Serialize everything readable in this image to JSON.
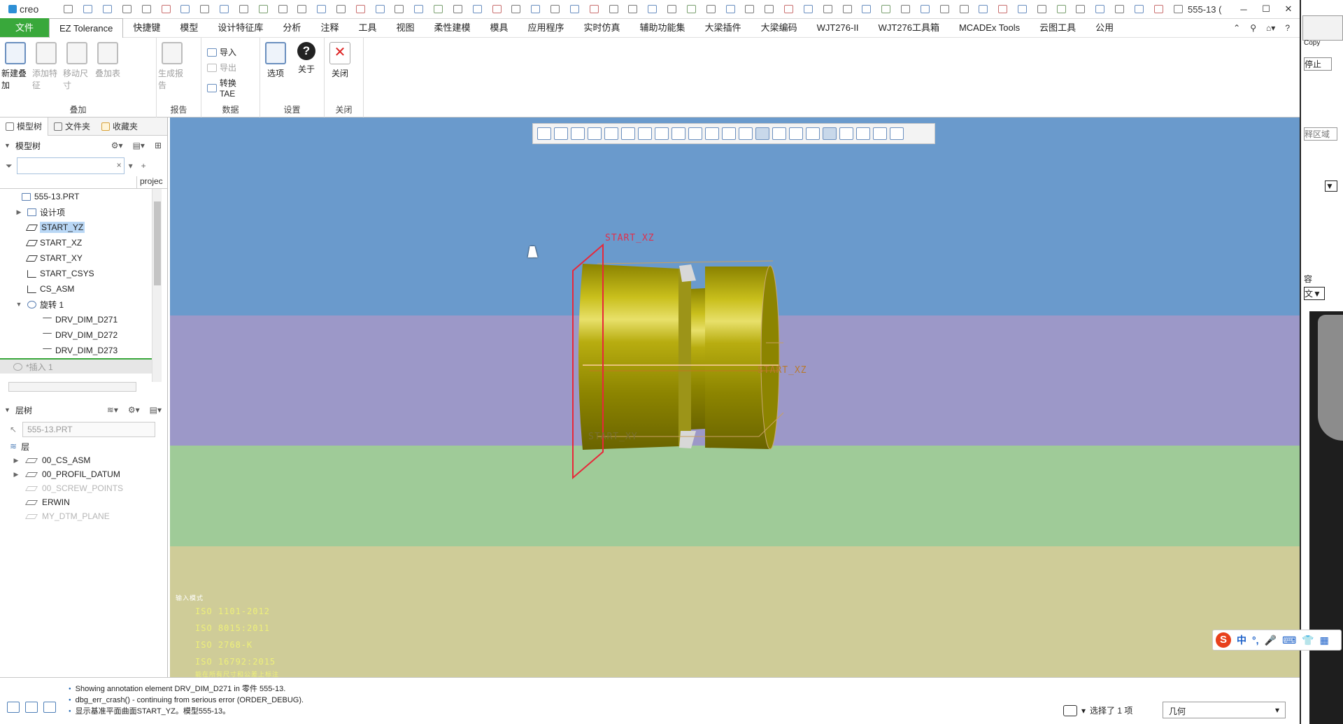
{
  "app": {
    "brand": "creo",
    "window_title": "555-13 (",
    "win_min": "─",
    "win_max": "☐",
    "win_close": "✕"
  },
  "menus": [
    "文件",
    "EZ Tolerance",
    "快捷键",
    "模型",
    "设计特征库",
    "分析",
    "注释",
    "工具",
    "视图",
    "柔性建模",
    "模具",
    "应用程序",
    "实时仿真",
    "辅助功能集",
    "大梁插件",
    "大梁编码",
    "WJT276-II",
    "WJT276工具箱",
    "MCADEx Tools",
    "云图工具",
    "公用"
  ],
  "menu_right": [
    "⌃",
    "⚲",
    "⌂▾",
    "?"
  ],
  "ribbon": {
    "groups": [
      {
        "label": "叠加",
        "buttons": [
          {
            "label": "新建叠加",
            "enabled": true
          },
          {
            "label": "添加特征",
            "enabled": false
          },
          {
            "label": "移动尺寸",
            "enabled": false
          },
          {
            "label": "叠加表",
            "enabled": false
          }
        ]
      },
      {
        "label": "报告",
        "buttons": [
          {
            "label": "生成报告",
            "enabled": false
          }
        ]
      },
      {
        "label": "数据",
        "items": [
          {
            "label": "导入",
            "enabled": true
          },
          {
            "label": "导出",
            "enabled": false
          },
          {
            "label": "转换 TAE",
            "enabled": true
          }
        ]
      },
      {
        "label": "设置",
        "buttons": [
          {
            "label": "选项",
            "enabled": true
          },
          {
            "label": "关于",
            "enabled": true
          }
        ]
      },
      {
        "label": "关闭",
        "buttons": [
          {
            "label": "关闭",
            "enabled": true
          }
        ]
      }
    ]
  },
  "panel": {
    "tabs": [
      "模型树",
      "文件夹",
      "收藏夹"
    ],
    "model_tree_title": "模型树",
    "column_header": "projec",
    "filter_value": "",
    "filter_clear": "×",
    "tree": [
      {
        "label": "555-13.PRT",
        "level": 0,
        "icon": "part",
        "exp": ""
      },
      {
        "label": "设计项",
        "level": 1,
        "icon": "part",
        "exp": "▶"
      },
      {
        "label": "START_YZ",
        "level": 1,
        "icon": "plane",
        "exp": "",
        "selected": true
      },
      {
        "label": "START_XZ",
        "level": 1,
        "icon": "plane",
        "exp": ""
      },
      {
        "label": "START_XY",
        "level": 1,
        "icon": "plane",
        "exp": ""
      },
      {
        "label": "START_CSYS",
        "level": 1,
        "icon": "csys",
        "exp": ""
      },
      {
        "label": "CS_ASM",
        "level": 1,
        "icon": "csys",
        "exp": ""
      },
      {
        "label": "旋转 1",
        "level": 1,
        "icon": "rev",
        "exp": "▼"
      },
      {
        "label": "DRV_DIM_D271",
        "level": 2,
        "icon": "dim",
        "exp": ""
      },
      {
        "label": "DRV_DIM_D272",
        "level": 2,
        "icon": "dim",
        "exp": ""
      },
      {
        "label": "DRV_DIM_D273",
        "level": 2,
        "icon": "dim",
        "exp": ""
      }
    ],
    "insert_here": "*插入 1",
    "layer_title": "层树",
    "layer_selector": "555-13.PRT",
    "layer_root": "层",
    "layers": [
      {
        "label": "00_CS_ASM",
        "exp": "▶",
        "dim": false
      },
      {
        "label": "00_PROFIL_DATUM",
        "exp": "▶",
        "dim": false
      },
      {
        "label": "00_SCREW_POINTS",
        "exp": "",
        "dim": true
      },
      {
        "label": "ERWIN",
        "exp": "",
        "dim": false
      },
      {
        "label": "MY_DTM_PLANE",
        "exp": "",
        "dim": true
      }
    ]
  },
  "viewport": {
    "datum_labels": {
      "top": "START_XZ",
      "right": "START_XZ",
      "bottom": "START_XY"
    },
    "iso_header": "输入模式",
    "iso_lines": [
      "ISO 1101-2012",
      "ISO 8015:2011",
      "ISO 2768-K",
      "ISO 16792:2015"
    ],
    "iso_footer": "能在所有尺寸和公差上标注"
  },
  "status": {
    "messages": [
      "Showing annotation element DRV_DIM_D271 in 零件 555-13.",
      "dbg_err_crash() - continuing from serious error (ORDER_DEBUG).",
      "显示基准平面曲面START_YZ。模型555-13。"
    ],
    "selection": "选择了 1 项",
    "filter": "几何",
    "filter_arrow": "▾"
  },
  "right_strip": {
    "copy": "Copy",
    "stop": "停止",
    "region": "释区域",
    "contain": "容",
    "arrow": "▼",
    "arrow2": "文▼"
  },
  "ime": {
    "logo": "S",
    "lang": "中",
    "punct": "°,",
    "mic": "🎤",
    "kbd": "⌨",
    "shirt": "👕",
    "grid": "▦"
  },
  "colors": {
    "file_tab": "#39a83b",
    "vp_band1": "#6a9acc",
    "vp_band2": "#9c98c8",
    "vp_band3": "#9fcb98",
    "vp_band4": "#cfcc98",
    "part": "#b4a812",
    "datum": "#e8283a"
  }
}
